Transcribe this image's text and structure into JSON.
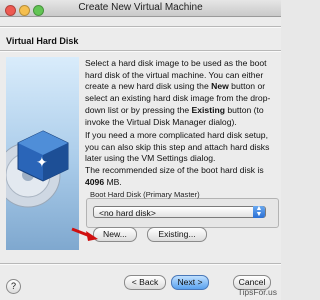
{
  "window": {
    "title": "Create New Virtual Machine"
  },
  "section_title": "Virtual Hard Disk",
  "description": {
    "p1_a": "Select a hard disk image to be used as the boot hard disk of the virtual machine. You can either create a new hard disk using the ",
    "p1_new": "New",
    "p1_b": " button or select an existing hard disk image from the drop-down list or by pressing the ",
    "p1_existing": "Existing",
    "p1_c": " button (to invoke the Virtual Disk Manager dialog).",
    "p2": "If you need a more complicated hard disk setup, you can also skip this step and attach hard disks later using the VM Settings dialog.",
    "p3_a": "The recommended size of the boot hard disk is ",
    "p3_size": "4096",
    "p3_b": " MB."
  },
  "boot_disk": {
    "group_label": "Boot Hard Disk (Primary Master)",
    "selected": "<no hard disk>",
    "new_label": "New...",
    "existing_label": "Existing..."
  },
  "footer": {
    "help": "?",
    "back_label": "< Back",
    "next_label": "Next >",
    "cancel_label": "Cancel",
    "watermark": "TipsFor.us"
  },
  "colors": {
    "annotation_arrow": "#d01010",
    "primary_button": "#5aa2ef"
  }
}
